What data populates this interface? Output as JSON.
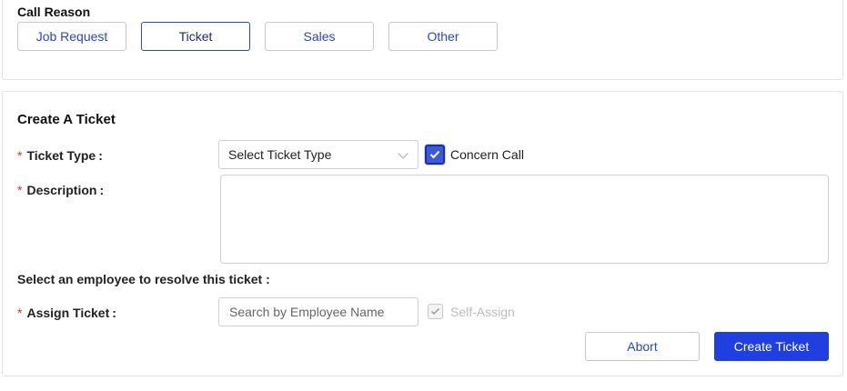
{
  "call_reason": {
    "title": "Call Reason",
    "buttons": [
      {
        "label": "Job Request",
        "selected": false
      },
      {
        "label": "Ticket",
        "selected": true
      },
      {
        "label": "Sales",
        "selected": false
      },
      {
        "label": "Other",
        "selected": false
      }
    ]
  },
  "create_ticket": {
    "title": "Create A Ticket",
    "required_mark": "*",
    "ticket_type": {
      "label": "Ticket Type",
      "colon": ":",
      "select_value": "Select Ticket Type"
    },
    "concern_call": {
      "label": "Concern Call",
      "checked": true
    },
    "description": {
      "label": "Description",
      "colon": ":",
      "value": ""
    },
    "employee_section": "Select an employee to resolve this ticket :",
    "assign_ticket": {
      "label": "Assign Ticket",
      "colon": ":",
      "placeholder": "Search by Employee Name"
    },
    "self_assign": {
      "label": "Self-Assign",
      "checked": true,
      "disabled": true
    },
    "actions": {
      "abort_label": "Abort",
      "create_label": "Create Ticket"
    }
  },
  "colors": {
    "accent": "#1f3fe0",
    "link_text": "#2a46c9",
    "required": "#e0302a"
  },
  "icons": {
    "select_arrow": "chevron-down-icon",
    "check": "checkmark-icon"
  }
}
